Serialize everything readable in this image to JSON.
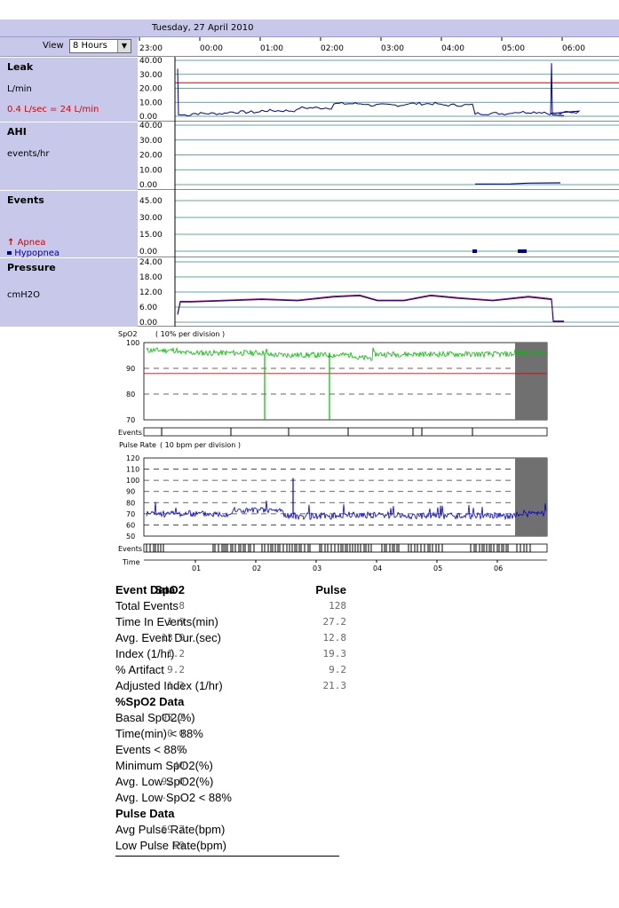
{
  "header": {
    "date": "Tuesday, 27 April 2010",
    "view_label": "View",
    "view_value": "8 Hours"
  },
  "time_ticks": [
    "23:00",
    "00:00",
    "01:00",
    "02:00",
    "03:00",
    "04:00",
    "05:00",
    "06:00"
  ],
  "panels": {
    "leak": {
      "title": "Leak",
      "unit": "L/min",
      "note": "0.4 L/sec = 24 L/min",
      "ticks": [
        "40.00",
        "30.00",
        "20.00",
        "10.00",
        "0.00"
      ]
    },
    "ahi": {
      "title": "AHI",
      "unit": "events/hr",
      "ticks": [
        "40.00",
        "30.00",
        "20.00",
        "10.00",
        "0.00"
      ]
    },
    "events": {
      "title": "Events",
      "ticks": [
        "45.00",
        "30.00",
        "15.00",
        "0.00"
      ],
      "legend_apnea": "Apnea",
      "legend_hypopnea": "Hypopnea"
    },
    "pressure": {
      "title": "Pressure",
      "unit": "cmH2O",
      "ticks": [
        "24.00",
        "18.00",
        "12.00",
        "6.00",
        "0.00"
      ]
    }
  },
  "oximetry": {
    "spo2_title": "SpO2",
    "spo2_note": "( 10% per division )",
    "spo2_ticks": [
      "100",
      "90",
      "80",
      "70"
    ],
    "pulse_title": "Pulse Rate",
    "pulse_note": "( 10 bpm per division )",
    "pulse_ticks": [
      "120",
      "110",
      "100",
      "90",
      "80",
      "70",
      "60",
      "50"
    ],
    "events_label": "Events",
    "time_label": "Time",
    "time_ticks": [
      "01",
      "02",
      "03",
      "04",
      "05",
      "06"
    ]
  },
  "report": {
    "header": {
      "label": "Event Data",
      "spo2": "SpO2",
      "pulse": "Pulse"
    },
    "event_rows": [
      {
        "label": "Total Events",
        "spo2": "8",
        "pulse": "128"
      },
      {
        "label": "Time In Events(min)",
        "spo2": "1.9",
        "pulse": "27.2"
      },
      {
        "label": "Avg. Event Dur.(sec)",
        "spo2": "13.9",
        "pulse": "12.8"
      },
      {
        "label": "Index (1/hr)",
        "spo2": "1.2",
        "pulse": "19.3"
      },
      {
        "label": "% Artifact",
        "spo2": "9.2",
        "pulse": "9.2"
      },
      {
        "label": "Adjusted Index (1/hr)",
        "spo2": "1.3",
        "pulse": "21.3"
      }
    ],
    "spo2_section": "%SpO2 Data",
    "spo2_rows": [
      {
        "label": "Basal SpO2(%)",
        "value": "95.2"
      },
      {
        "label": "Time(min) < 88%",
        "value": "0.0"
      },
      {
        "label": "Events < 88%",
        "value": "0"
      },
      {
        "label": "Minimum SpO2(%)",
        "value": "40"
      },
      {
        "label": "Avg. Low SpO2(%)",
        "value": "92.0"
      },
      {
        "label": "Avg. Low SpO2 < 88%",
        "value": "----"
      }
    ],
    "pulse_section": "Pulse Data",
    "pulse_rows": [
      {
        "label": "Avg Pulse Rate(bpm)",
        "value": "69.7"
      },
      {
        "label": "Low Pulse Rate(bpm)",
        "value": "59"
      }
    ]
  },
  "colors": {
    "label_bg": "#c8c8ea",
    "leak_line": "#0000a0",
    "threshold": "#d00000",
    "spo2_line": "#00c000",
    "pulse_line": "#0000e0",
    "grid": "#2a8a8a"
  }
}
